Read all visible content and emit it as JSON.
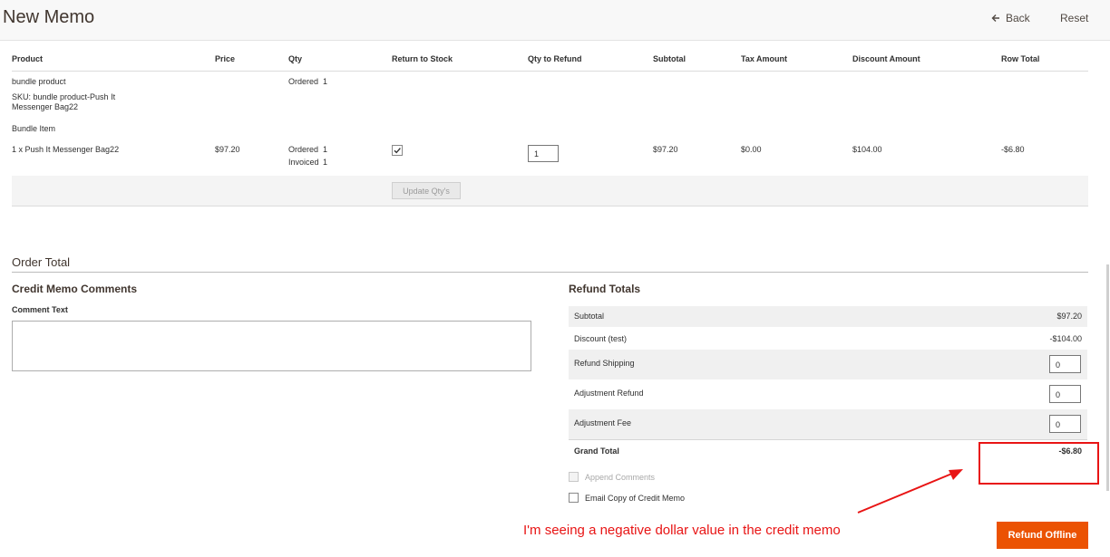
{
  "header": {
    "title": "New Memo",
    "back_label": "Back",
    "reset_label": "Reset"
  },
  "items_table": {
    "columns": {
      "product": "Product",
      "price": "Price",
      "qty": "Qty",
      "return_to_stock": "Return to Stock",
      "qty_to_refund": "Qty to Refund",
      "subtotal": "Subtotal",
      "tax_amount": "Tax Amount",
      "discount_amount": "Discount Amount",
      "row_total": "Row Total"
    },
    "parent": {
      "name": "bundle product",
      "sku": "SKU: bundle product-Push It Messenger Bag22",
      "ordered_label": "Ordered",
      "ordered_qty": "1"
    },
    "bundle_item_label": "Bundle Item",
    "child": {
      "name": "1 x Push It Messenger Bag22",
      "price": "$97.20",
      "ordered_label": "Ordered",
      "ordered_qty": "1",
      "invoiced_label": "Invoiced",
      "invoiced_qty": "1",
      "return_to_stock_checked": true,
      "qty_to_refund": "1",
      "subtotal": "$97.20",
      "tax_amount": "$0.00",
      "discount_amount": "$104.00",
      "row_total": "-$6.80"
    },
    "update_button_label": "Update Qty's"
  },
  "order_total": {
    "section_title": "Order Total",
    "comments": {
      "title": "Credit Memo Comments",
      "comment_label": "Comment Text",
      "comment_value": ""
    },
    "refund_totals": {
      "title": "Refund Totals",
      "subtotal_label": "Subtotal",
      "subtotal_value": "$97.20",
      "discount_label": "Discount (test)",
      "discount_value": "-$104.00",
      "shipping_label": "Refund Shipping",
      "shipping_value": "0",
      "adj_refund_label": "Adjustment Refund",
      "adj_refund_value": "0",
      "adj_fee_label": "Adjustment Fee",
      "adj_fee_value": "0",
      "grand_total_label": "Grand Total",
      "grand_total_value": "-$6.80",
      "append_comments_label": "Append Comments",
      "email_copy_label": "Email Copy of Credit Memo",
      "refund_button_label": "Refund Offline"
    }
  },
  "annotation": {
    "text": "I'm seeing a negative dollar value in the credit memo",
    "color": "#e81414"
  },
  "colors": {
    "accent": "#eb5202",
    "title": "#41362f"
  }
}
